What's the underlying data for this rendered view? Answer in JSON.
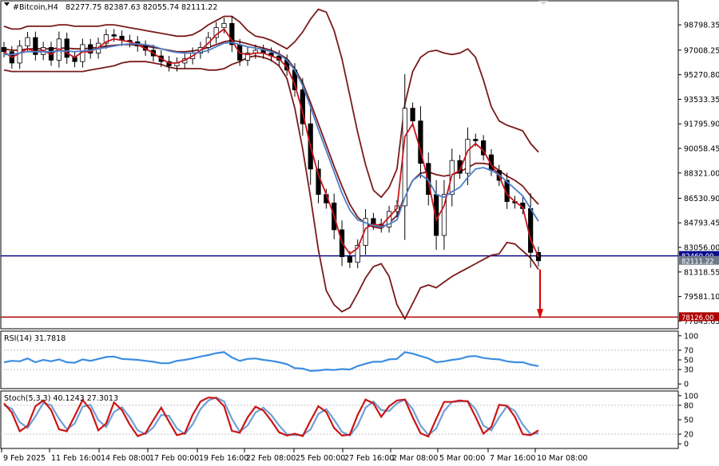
{
  "chart_data": {
    "type": "line",
    "instrument": "#Bitcoin,H4",
    "ohlc": "82277.75 82387.63 82055.74 82111.22",
    "price_axis": {
      "ticks": [
        "98798.35",
        "97008.25",
        "95270.80",
        "93533.35",
        "91795.90",
        "90058.45",
        "88321.00",
        "86530.90",
        "84793.45",
        "83056.00",
        "81318.55",
        "79581.10",
        "77843.65"
      ],
      "tick_values": [
        98798.35,
        97008.25,
        95270.8,
        93533.35,
        91795.9,
        90058.45,
        88321.0,
        86530.9,
        84793.45,
        83056.0,
        81318.55,
        79581.1,
        77843.65
      ],
      "range": [
        77300,
        100500
      ],
      "labels": [
        {
          "text": "82460.00",
          "value": 82460.0,
          "color": "#0a0a8c"
        },
        {
          "text": "82111.22",
          "value": 82111.22,
          "color": "#6e7b8b"
        },
        {
          "text": "78126.00",
          "value": 78126.0,
          "color": "#b00000"
        }
      ],
      "hlines": [
        {
          "value": 82460.0,
          "color": "#0a0a8c"
        },
        {
          "value": 78126.0,
          "color": "#b00000"
        }
      ]
    },
    "x_labels": [
      "9 Feb 2025",
      "11 Feb 16:00",
      "14 Feb 08:00",
      "17 Feb 00:00",
      "19 Feb 16:00",
      "22 Feb 08:00",
      "25 Feb 00:00",
      "27 Feb 16:00",
      "2 Mar 08:00",
      "5 Mar 00:00",
      "7 Mar 16:00",
      "10 Mar 08:00"
    ],
    "closes": [
      96900,
      96100,
      97300,
      97900,
      96700,
      97200,
      96300,
      97800,
      96500,
      96200,
      97400,
      96800,
      97500,
      98100,
      98000,
      97700,
      97600,
      97300,
      97000,
      96600,
      96200,
      95900,
      96100,
      96400,
      96800,
      97200,
      97900,
      98600,
      98900,
      97400,
      96300,
      96800,
      97000,
      96800,
      96600,
      96300,
      95600,
      94200,
      91800,
      88600,
      86800,
      86200,
      84300,
      82400,
      82000,
      83200,
      85100,
      84700,
      84500,
      85600,
      86000,
      92900,
      92000,
      89000,
      86800,
      83900,
      86800,
      89200,
      88300,
      90700,
      90600,
      89600,
      88500,
      87800,
      86300,
      86200,
      85800,
      82700,
      82111
    ],
    "series": [
      {
        "name": "Moving Average",
        "color": "#c8141e",
        "values": [
          96900,
          96500,
          96800,
          97100,
          96900,
          97000,
          96700,
          97100,
          96800,
          96500,
          96900,
          96900,
          97200,
          97600,
          97800,
          97700,
          97600,
          97400,
          97100,
          96800,
          96400,
          96100,
          96100,
          96300,
          96600,
          97000,
          97500,
          98100,
          98500,
          97700,
          96800,
          96700,
          96800,
          96800,
          96600,
          96400,
          95800,
          94600,
          92600,
          90200,
          88200,
          86800,
          85300,
          83400,
          82600,
          83000,
          84400,
          84700,
          84600,
          85200,
          85800,
          90900,
          91800,
          89900,
          87700,
          85000,
          86000,
          88200,
          88500,
          89900,
          90400,
          89900,
          88900,
          88100,
          86800,
          86300,
          85900,
          83600,
          82400
        ]
      },
      {
        "name": "Moving Average",
        "color": "#4c7ec8",
        "values": [
          96700,
          96700,
          96800,
          96900,
          96900,
          96900,
          96900,
          96950,
          96950,
          96900,
          96950,
          97000,
          97100,
          97200,
          97300,
          97400,
          97450,
          97450,
          97400,
          97300,
          97100,
          96950,
          96850,
          96800,
          96800,
          96850,
          97000,
          97250,
          97500,
          97550,
          97400,
          97250,
          97150,
          97050,
          96900,
          96700,
          96300,
          95600,
          94500,
          93000,
          91400,
          89900,
          88400,
          86900,
          85700,
          85000,
          84800,
          84600,
          84500,
          84700,
          85000,
          86600,
          87800,
          88200,
          87800,
          86800,
          86600,
          87000,
          87300,
          88000,
          88600,
          88700,
          88500,
          88200,
          87700,
          87200,
          86700,
          85800,
          84900
        ]
      }
    ],
    "bands": [
      {
        "name": "upper",
        "color": "#7a1a1a",
        "values": [
          98700,
          98500,
          98500,
          98700,
          98700,
          98700,
          98700,
          98800,
          98800,
          98700,
          98700,
          98700,
          98700,
          98800,
          98800,
          98700,
          98600,
          98500,
          98400,
          98300,
          98200,
          98100,
          98000,
          98000,
          98100,
          98400,
          98800,
          99100,
          99400,
          99400,
          99000,
          98400,
          98000,
          97900,
          97700,
          97400,
          97100,
          97600,
          98300,
          99200,
          99900,
          99700,
          98400,
          96400,
          93800,
          91200,
          88900,
          87100,
          86600,
          87300,
          88600,
          93200,
          95500,
          96500,
          96900,
          97000,
          96800,
          96700,
          96800,
          97100,
          96500,
          94900,
          93000,
          92000,
          91700,
          91500,
          91300,
          90400,
          89800
        ]
      },
      {
        "name": "middle",
        "color": "#7a1a1a",
        "values": [
          97100,
          97000,
          97000,
          97100,
          97100,
          97100,
          97100,
          97150,
          97150,
          97100,
          97100,
          97150,
          97200,
          97300,
          97350,
          97400,
          97400,
          97350,
          97300,
          97200,
          97100,
          97000,
          96900,
          96900,
          96950,
          97050,
          97200,
          97400,
          97600,
          97700,
          97600,
          97450,
          97300,
          97150,
          97000,
          96750,
          96400,
          95700,
          94700,
          93300,
          91800,
          90300,
          88800,
          87400,
          86100,
          85200,
          84700,
          84500,
          84400,
          84800,
          85300,
          86700,
          87800,
          88300,
          88400,
          88200,
          88100,
          88200,
          88400,
          88700,
          89000,
          89000,
          88900,
          88500,
          88100,
          87800,
          87400,
          86700,
          86100
        ]
      },
      {
        "name": "lower",
        "color": "#7a1a1a",
        "values": [
          95600,
          95500,
          95500,
          95500,
          95500,
          95500,
          95500,
          95500,
          95500,
          95500,
          95500,
          95600,
          95700,
          95800,
          95900,
          96100,
          96200,
          96200,
          96200,
          96100,
          96000,
          95800,
          95700,
          95700,
          95700,
          95700,
          95600,
          95600,
          95700,
          96000,
          96200,
          96500,
          96600,
          96500,
          96300,
          95900,
          95000,
          92900,
          90000,
          86600,
          82900,
          80000,
          79000,
          78500,
          78800,
          79800,
          80900,
          81700,
          81900,
          81000,
          79000,
          78000,
          79100,
          80200,
          80400,
          80200,
          80600,
          81000,
          81300,
          81600,
          81900,
          82200,
          82500,
          82600,
          83400,
          83300,
          82800,
          82300,
          81500
        ]
      }
    ],
    "rsi": {
      "title": "RSI(14) 31.7818",
      "color": "#3c8ee0",
      "ticks": [
        "100",
        "70",
        "50",
        "30",
        "0"
      ],
      "tick_values": [
        100,
        70,
        50,
        30,
        0
      ],
      "range": [
        -8,
        108
      ],
      "values": [
        45,
        48,
        47,
        53,
        45,
        50,
        47,
        51,
        45,
        44,
        51,
        48,
        52,
        56,
        57,
        52,
        51,
        50,
        48,
        46,
        43,
        43,
        48,
        50,
        53,
        57,
        60,
        64,
        66,
        55,
        48,
        52,
        53,
        50,
        48,
        45,
        41,
        33,
        32,
        27,
        28,
        30,
        29,
        31,
        30,
        37,
        42,
        46,
        46,
        51,
        52,
        66,
        63,
        58,
        53,
        45,
        47,
        50,
        52,
        57,
        58,
        54,
        52,
        51,
        47,
        45,
        45,
        40,
        37
      ]
    },
    "stoch": {
      "title": "Stoch(5,3,3) 40.1243 27.3013",
      "ticks": [
        "100",
        "80",
        "50",
        "20",
        "0"
      ],
      "tick_values": [
        100,
        80,
        50,
        20,
        0
      ],
      "range": [
        -8,
        108
      ],
      "main": {
        "name": "%K",
        "color": "#cc1414",
        "values": [
          84,
          65,
          26,
          37,
          78,
          90,
          70,
          30,
          26,
          58,
          91,
          71,
          28,
          42,
          86,
          70,
          40,
          16,
          22,
          49,
          75,
          46,
          18,
          22,
          60,
          88,
          96,
          95,
          78,
          27,
          23,
          55,
          77,
          69,
          48,
          24,
          17,
          21,
          16,
          48,
          78,
          66,
          33,
          17,
          19,
          60,
          92,
          84,
          56,
          78,
          90,
          92,
          55,
          22,
          15,
          52,
          87,
          87,
          90,
          88,
          56,
          21,
          35,
          81,
          79,
          56,
          20,
          18,
          28
        ]
      },
      "signal": {
        "name": "%D",
        "color": "#6f9fd8",
        "values": [
          80,
          73,
          45,
          33,
          57,
          85,
          80,
          52,
          30,
          42,
          77,
          81,
          49,
          35,
          66,
          76,
          55,
          28,
          20,
          34,
          60,
          58,
          32,
          20,
          40,
          72,
          90,
          96,
          88,
          52,
          25,
          38,
          65,
          75,
          60,
          38,
          20,
          18,
          18,
          30,
          62,
          72,
          50,
          25,
          17,
          38,
          75,
          88,
          70,
          68,
          84,
          92,
          72,
          38,
          18,
          32,
          68,
          87,
          88,
          89,
          72,
          38,
          28,
          55,
          78,
          68,
          40,
          20,
          22
        ]
      }
    }
  }
}
